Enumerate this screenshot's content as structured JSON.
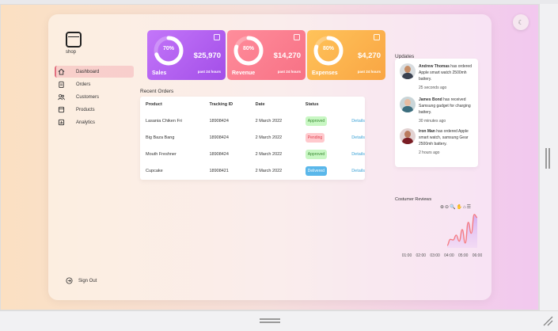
{
  "app": {
    "logo_text": "shop"
  },
  "nav": {
    "items": [
      {
        "label": "Dashboard",
        "icon": "home-icon",
        "active": true
      },
      {
        "label": "Orders",
        "icon": "clipboard-icon",
        "active": false
      },
      {
        "label": "Customers",
        "icon": "users-icon",
        "active": false
      },
      {
        "label": "Products",
        "icon": "box-icon",
        "active": false
      },
      {
        "label": "Analytics",
        "icon": "chart-icon",
        "active": false
      }
    ],
    "signout_label": "Sign Out"
  },
  "stats": [
    {
      "title": "Sales",
      "percent": "70%",
      "percent_value": 70,
      "value": "$25,970",
      "period": "past 24 hours",
      "color": "#b45ff0"
    },
    {
      "title": "Revenue",
      "percent": "80%",
      "percent_value": 80,
      "value": "$14,270",
      "period": "past 24 hours",
      "color": "#fb7d8e"
    },
    {
      "title": "Expenses",
      "percent": "80%",
      "percent_value": 80,
      "value": "$4,270",
      "period": "past 24 hours",
      "color": "#fdb64f"
    }
  ],
  "orders": {
    "title": "Recent Orders",
    "columns": [
      "Product",
      "Tracking ID",
      "Date",
      "Status",
      ""
    ],
    "rows": [
      {
        "product": "Lasania Chiken Fri",
        "tracking": "18908424",
        "date": "2 March 2022",
        "status": "Approved",
        "status_bg": "#c8f7c3",
        "status_color": "#3a8a33",
        "action": "Details"
      },
      {
        "product": "Big Baza Bang",
        "tracking": "18908424",
        "date": "2 March 2022",
        "status": "Pending",
        "status_bg": "#ffc9cd",
        "status_color": "#e0404f",
        "action": "Details"
      },
      {
        "product": "Mouth Freshner",
        "tracking": "18908424",
        "date": "2 March 2022",
        "status": "Approved",
        "status_bg": "#c8f7c3",
        "status_color": "#3a8a33",
        "action": "Details"
      },
      {
        "product": "Cupcake",
        "tracking": "18908421",
        "date": "2 March 2022",
        "status": "Delivered",
        "status_bg": "#5ab7ea",
        "status_color": "#ffffff",
        "action": "Details"
      }
    ]
  },
  "updates": {
    "title": "Updates",
    "items": [
      {
        "name": "Andrew Thomas",
        "text": "has ordered Apple smart watch 2500mh battery.",
        "time": "25 seconds ago",
        "skin": "#c58c66",
        "shirt": "#3a4150"
      },
      {
        "name": "James Bond",
        "text": "has received Samsung gadget for charging battery.",
        "time": "30 minutes ago",
        "skin": "#e7bca1",
        "shirt": "#3c6e7e"
      },
      {
        "name": "Iron Man",
        "text": "has ordered Apple smart watch, samsung Gear 2500mh battery.",
        "time": "2 hours ago",
        "skin": "#b97a5d",
        "shirt": "#7a1d24"
      }
    ]
  },
  "reviews": {
    "title": "Costumer Reviews",
    "tools": "⊕⊖🔍✋⌂☰"
  },
  "chart_data": {
    "type": "area",
    "x": [
      "01:00",
      "02:00",
      "03:00",
      "04:00",
      "05:00",
      "06:00"
    ],
    "series": [
      {
        "values": [
          8,
          28,
          26,
          42,
          22,
          60,
          16,
          84,
          48,
          110,
          100
        ]
      }
    ],
    "ylim": [
      0,
      120
    ],
    "color": "#f57c82"
  }
}
